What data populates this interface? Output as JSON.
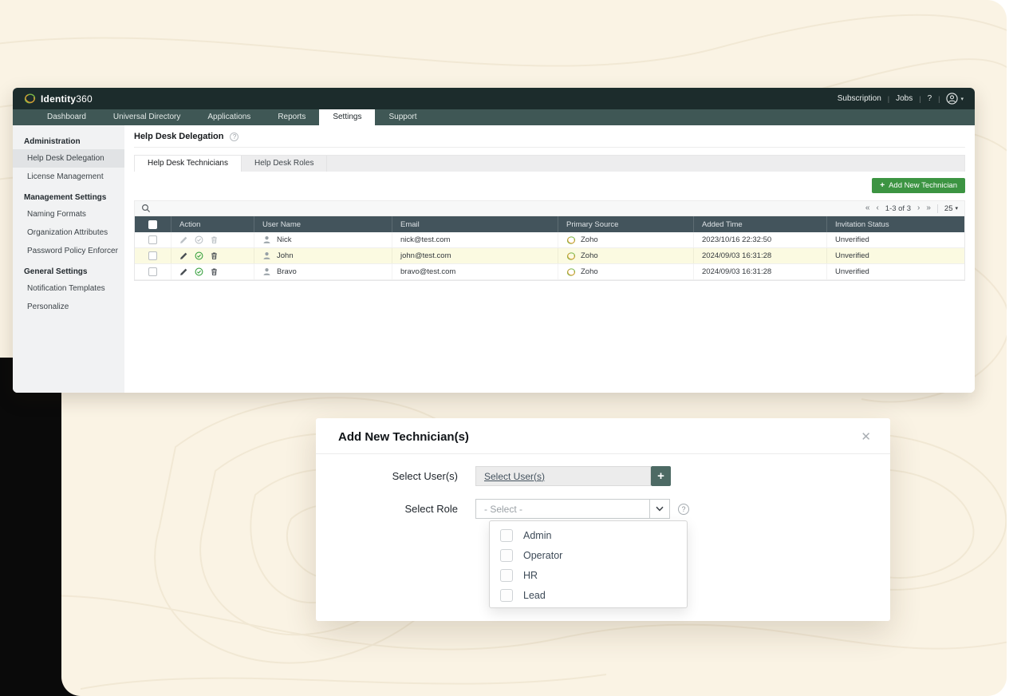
{
  "background": {
    "cream": "#faf3e4",
    "black_card": "#0a0a0a"
  },
  "window": {
    "topbar": {
      "brand_bold": "Identity",
      "brand_regular": "360",
      "menu": [
        "Subscription",
        "Jobs"
      ],
      "help_label": "?"
    },
    "nav": {
      "items": [
        "Dashboard",
        "Universal Directory",
        "Applications",
        "Reports",
        "Settings",
        "Support"
      ],
      "active": "Settings"
    },
    "sidebar": {
      "sections": [
        {
          "title": "Administration",
          "items": [
            {
              "label": "Help Desk Delegation",
              "active": true
            },
            {
              "label": "License Management",
              "active": false
            }
          ]
        },
        {
          "title": "Management Settings",
          "items": [
            {
              "label": "Naming Formats"
            },
            {
              "label": "Organization Attributes"
            },
            {
              "label": "Password Policy Enforcer"
            }
          ]
        },
        {
          "title": "General Settings",
          "items": [
            {
              "label": "Notification Templates"
            },
            {
              "label": "Personalize"
            }
          ]
        }
      ]
    },
    "page": {
      "title": "Help Desk Delegation"
    },
    "tabs": [
      {
        "label": "Help Desk Technicians",
        "active": true
      },
      {
        "label": "Help Desk Roles",
        "active": false
      }
    ],
    "actions": {
      "add_button": "Add New Technician",
      "add_icon": "+"
    },
    "list_toolbar": {
      "pagination": {
        "first": "«",
        "prev": "‹",
        "range": "1-3 of 3",
        "next": "›",
        "last": "»",
        "page_size": "25",
        "caret": "▾"
      }
    },
    "table": {
      "headers": [
        "Action",
        "User Name",
        "Email",
        "Primary Source",
        "Added Time",
        "Invitation Status"
      ],
      "rows": [
        {
          "user": "Nick",
          "email": "nick@test.com",
          "source": "Zoho",
          "added": "2023/10/16 22:32:50",
          "status": "Unverified"
        },
        {
          "user": "John",
          "email": "john@test.com",
          "source": "Zoho",
          "added": "2024/09/03 16:31:28",
          "status": "Unverified"
        },
        {
          "user": "Bravo",
          "email": "bravo@test.com",
          "source": "Zoho",
          "added": "2024/09/03 16:31:28",
          "status": "Unverified"
        }
      ]
    }
  },
  "modal": {
    "title": "Add New Technician(s)",
    "close_icon": "✕",
    "select_users": {
      "label": "Select User(s)",
      "value": "Select User(s)",
      "add_icon": "+"
    },
    "select_role": {
      "label": "Select Role",
      "placeholder": "- Select -",
      "help": "?"
    },
    "role_options": [
      {
        "label": "Admin"
      },
      {
        "label": "Operator"
      },
      {
        "label": "HR"
      },
      {
        "label": "Lead"
      }
    ]
  },
  "colors": {
    "accent_green": "#3c9442",
    "topbar": "#1c2c2c",
    "navbar": "#3f5755",
    "table_header": "#43545c",
    "row_highlight": "#fbfae1",
    "modal_add_button": "#4d6a64"
  }
}
